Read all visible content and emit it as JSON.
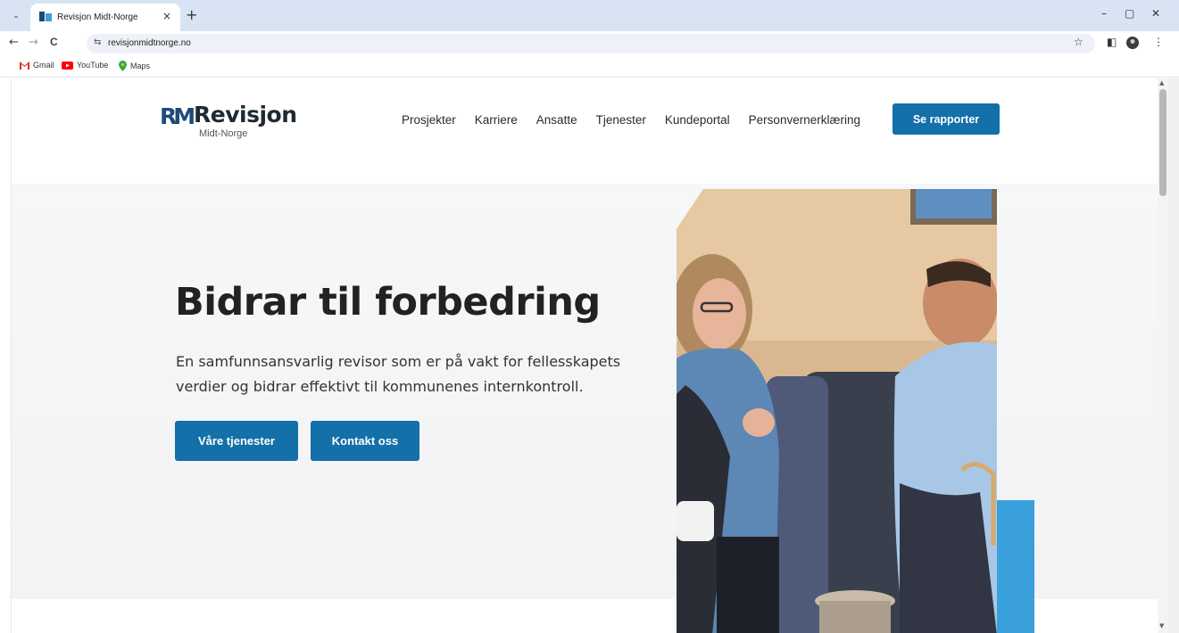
{
  "browser": {
    "tab_title": "Revisjon Midt-Norge",
    "tab_close": "×",
    "new_tab": "+",
    "tab_menu": "⌄",
    "url": "revisjonmidtnorge.no",
    "window_minimize": "–",
    "window_maximize": "▢",
    "window_close": "✕",
    "nav_back": "←",
    "nav_forward": "→",
    "nav_reload": "C",
    "site_info": "⇆",
    "star": "☆",
    "sidepanel": "◧",
    "menu": "⋮",
    "bookmarks": [
      {
        "label": "Gmail",
        "icon": "gmail-icon"
      },
      {
        "label": "YouTube",
        "icon": "youtube-icon"
      },
      {
        "label": "Maps",
        "icon": "maps-icon"
      }
    ]
  },
  "site": {
    "logo_mark": "RM",
    "logo_text": "Revisjon",
    "logo_sub": "Midt-Norge",
    "nav": [
      "Prosjekter",
      "Karriere",
      "Ansatte",
      "Tjenester",
      "Kundeportal",
      "Personvernerklæring"
    ],
    "cta": "Se rapporter",
    "accent_color": "#1370a8",
    "secondary_accent": "#3aa0db"
  },
  "hero": {
    "title": "Bidrar til forbedring",
    "lead": "En samfunnsansvarlig revisor som er på vakt for fellesskapets verdier og bidrar effektivt til kommunenes internkontroll.",
    "button_primary": "Våre tjenester",
    "button_secondary": "Kontakt oss"
  }
}
